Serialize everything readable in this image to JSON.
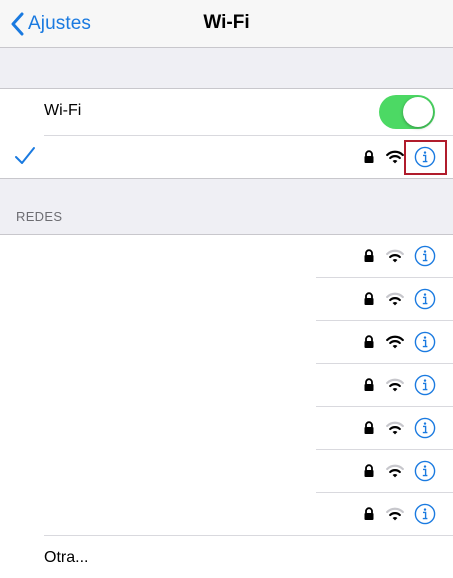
{
  "navbar": {
    "back_label": "Ajustes",
    "title": "Wi-Fi"
  },
  "wifi_toggle": {
    "label": "Wi-Fi",
    "state": "on",
    "on_color": "#4cd964"
  },
  "connected_network": {
    "selected": true,
    "locked": true,
    "signal_level": 3,
    "info_icon": "info-icon"
  },
  "networks_section": {
    "header": "REDES",
    "items": [
      {
        "locked": true,
        "signal_level": 2
      },
      {
        "locked": true,
        "signal_level": 2
      },
      {
        "locked": true,
        "signal_level": 3
      },
      {
        "locked": true,
        "signal_level": 2
      },
      {
        "locked": true,
        "signal_level": 2
      },
      {
        "locked": true,
        "signal_level": 2
      },
      {
        "locked": true,
        "signal_level": 2
      }
    ],
    "other_label": "Otra..."
  },
  "colors": {
    "accent": "#1a7ae0",
    "highlight": "#b01c2c",
    "background": "#efeff4"
  }
}
